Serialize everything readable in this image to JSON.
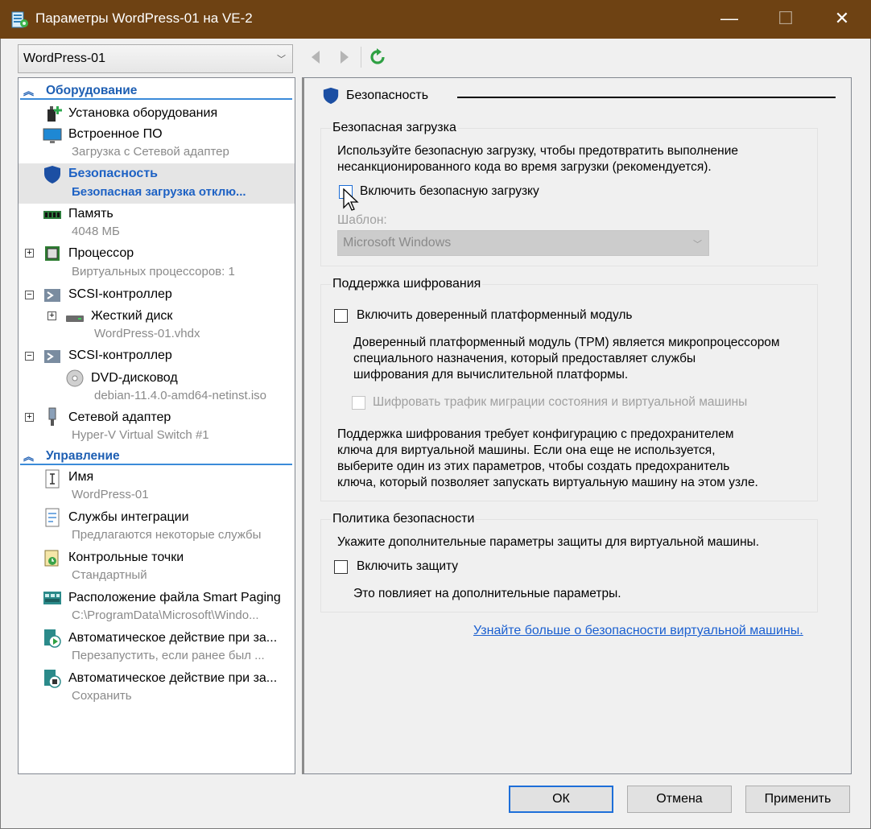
{
  "window": {
    "title": "Параметры WordPress-01 на VE-2",
    "minimize": "—",
    "maximize": "☐",
    "close": "✕"
  },
  "vm_selector": {
    "value": "WordPress-01"
  },
  "tree": {
    "sections": [
      {
        "label": "Оборудование"
      },
      {
        "label": "Управление"
      }
    ],
    "hardware": [
      {
        "label": "Установка оборудования",
        "sub": ""
      },
      {
        "label": "Встроенное ПО",
        "sub": "Загрузка с Сетевой адаптер"
      },
      {
        "label": "Безопасность",
        "sub": "Безопасная загрузка отклю..."
      },
      {
        "label": "Память",
        "sub": "4048 МБ"
      },
      {
        "label": "Процессор",
        "sub": "Виртуальных процессоров: 1"
      },
      {
        "label": "SCSI-контроллер",
        "sub": ""
      },
      {
        "label": "Жесткий диск",
        "sub": "WordPress-01.vhdx"
      },
      {
        "label": "SCSI-контроллер",
        "sub": ""
      },
      {
        "label": "DVD-дисковод",
        "sub": "debian-11.4.0-amd64-netinst.iso"
      },
      {
        "label": "Сетевой адаптер",
        "sub": "Hyper-V Virtual Switch #1"
      }
    ],
    "management": [
      {
        "label": "Имя",
        "sub": "WordPress-01"
      },
      {
        "label": "Службы интеграции",
        "sub": "Предлагаются некоторые службы"
      },
      {
        "label": "Контрольные точки",
        "sub": "Стандартный"
      },
      {
        "label": "Расположение файла Smart Paging",
        "sub": "C:\\ProgramData\\Microsoft\\Windo..."
      },
      {
        "label": "Автоматическое действие при за...",
        "sub": "Перезапустить, если ранее был ..."
      },
      {
        "label": "Автоматическое действие при за...",
        "sub": "Сохранить"
      }
    ]
  },
  "pane": {
    "heading": "Безопасность",
    "secure_boot": {
      "title": "Безопасная загрузка",
      "desc_line1": "Используйте безопасную загрузку, чтобы предотвратить выполнение",
      "desc_line2": "несанкционированного кода во время загрузки (рекомендуется).",
      "checkbox_label": "Включить безопасную загрузку",
      "checked": false,
      "template_label": "Шаблон:",
      "template_value": "Microsoft Windows"
    },
    "encryption": {
      "title": "Поддержка шифрования",
      "tpm_label": "Включить доверенный платформенный модуль",
      "tpm_checked": false,
      "tpm_desc_line1": "Доверенный платформенный модуль (TPM) является микропроцессором",
      "tpm_desc_line2": "специального назначения, который предоставляет службы",
      "tpm_desc_line3": "шифрования для вычислительной платформы.",
      "migration_label": "Шифровать трафик миграции состояния и виртуальной машины",
      "note_line1": "Поддержка шифрования требует конфигурацию с предохранителем",
      "note_line2": "ключа для виртуальной машины. Если она еще не используется,",
      "note_line3": "выберите один из этих параметров, чтобы создать предохранитель",
      "note_line4": "ключа, который позволяет запускать виртуальную машину на этом узле."
    },
    "policy": {
      "title": "Политика безопасности",
      "desc": "Укажите дополнительные параметры защиты для виртуальной машины.",
      "checkbox_label": "Включить защиту",
      "checked": false,
      "note": "Это повлияет на дополнительные параметры."
    },
    "learn_more_link": "Узнайте больше о безопасности виртуальной машины."
  },
  "buttons": {
    "ok": "ОК",
    "cancel": "Отмена",
    "apply": "Применить"
  },
  "colors": {
    "titlebar": "#6e4213",
    "accent": "#1e62c4",
    "selection": "#e5e5e5"
  }
}
